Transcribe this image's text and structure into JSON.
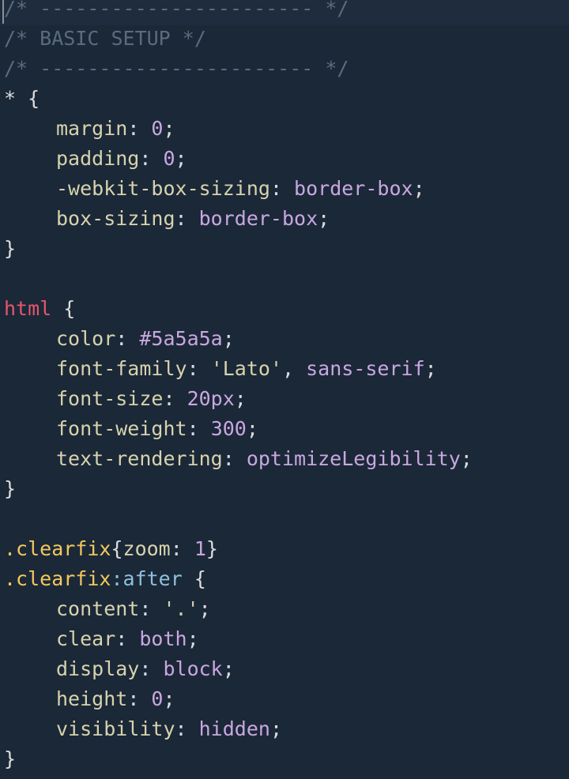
{
  "colors": {
    "background": "#1b2838",
    "comment": "#5b6b7c",
    "punctuation": "#dcdcdc",
    "property": "#d7d3ad",
    "value": "#c9a7e0",
    "number": "#c9a7e0",
    "tag": "#e5576b",
    "selector": "#f3c85c",
    "pseudo": "#8fc1dd",
    "string": "#d7d3ad"
  },
  "lines": [
    {
      "indent": false,
      "tokens": [
        {
          "t": "/* ----------------------- */",
          "c": "comment"
        }
      ]
    },
    {
      "indent": false,
      "tokens": [
        {
          "t": "/* BASIC SETUP */",
          "c": "comment"
        }
      ]
    },
    {
      "indent": false,
      "tokens": [
        {
          "t": "/* ----------------------- */",
          "c": "comment"
        }
      ]
    },
    {
      "indent": false,
      "tokens": [
        {
          "t": "* {",
          "c": "punctuation"
        }
      ]
    },
    {
      "indent": true,
      "tokens": [
        {
          "t": "margin",
          "c": "property"
        },
        {
          "t": ": ",
          "c": "punctuation"
        },
        {
          "t": "0",
          "c": "number"
        },
        {
          "t": ";",
          "c": "punctuation"
        }
      ]
    },
    {
      "indent": true,
      "tokens": [
        {
          "t": "padding",
          "c": "property"
        },
        {
          "t": ": ",
          "c": "punctuation"
        },
        {
          "t": "0",
          "c": "number"
        },
        {
          "t": ";",
          "c": "punctuation"
        }
      ]
    },
    {
      "indent": true,
      "tokens": [
        {
          "t": "-webkit-box-sizing",
          "c": "property"
        },
        {
          "t": ": ",
          "c": "punctuation"
        },
        {
          "t": "border-box",
          "c": "value"
        },
        {
          "t": ";",
          "c": "punctuation"
        }
      ]
    },
    {
      "indent": true,
      "tokens": [
        {
          "t": "box-sizing",
          "c": "property"
        },
        {
          "t": ": ",
          "c": "punctuation"
        },
        {
          "t": "border-box",
          "c": "value"
        },
        {
          "t": ";",
          "c": "punctuation"
        }
      ]
    },
    {
      "indent": false,
      "tokens": [
        {
          "t": "}",
          "c": "punctuation"
        }
      ]
    },
    {
      "indent": false,
      "tokens": []
    },
    {
      "indent": false,
      "tokens": [
        {
          "t": "html",
          "c": "tag"
        },
        {
          "t": " {",
          "c": "punctuation"
        }
      ]
    },
    {
      "indent": true,
      "tokens": [
        {
          "t": "color",
          "c": "property"
        },
        {
          "t": ": ",
          "c": "punctuation"
        },
        {
          "t": "#5a5a5a",
          "c": "value"
        },
        {
          "t": ";",
          "c": "punctuation"
        }
      ]
    },
    {
      "indent": true,
      "tokens": [
        {
          "t": "font-family",
          "c": "property"
        },
        {
          "t": ": ",
          "c": "punctuation"
        },
        {
          "t": "'Lato'",
          "c": "string"
        },
        {
          "t": ", ",
          "c": "punctuation"
        },
        {
          "t": "sans-serif",
          "c": "value"
        },
        {
          "t": ";",
          "c": "punctuation"
        }
      ]
    },
    {
      "indent": true,
      "tokens": [
        {
          "t": "font-size",
          "c": "property"
        },
        {
          "t": ": ",
          "c": "punctuation"
        },
        {
          "t": "20px",
          "c": "number"
        },
        {
          "t": ";",
          "c": "punctuation"
        }
      ]
    },
    {
      "indent": true,
      "tokens": [
        {
          "t": "font-weight",
          "c": "property"
        },
        {
          "t": ": ",
          "c": "punctuation"
        },
        {
          "t": "300",
          "c": "number"
        },
        {
          "t": ";",
          "c": "punctuation"
        }
      ]
    },
    {
      "indent": true,
      "tokens": [
        {
          "t": "text-rendering",
          "c": "property"
        },
        {
          "t": ": ",
          "c": "punctuation"
        },
        {
          "t": "optimizeLegibility",
          "c": "value"
        },
        {
          "t": ";",
          "c": "punctuation"
        }
      ]
    },
    {
      "indent": false,
      "tokens": [
        {
          "t": "}",
          "c": "punctuation"
        }
      ]
    },
    {
      "indent": false,
      "tokens": []
    },
    {
      "indent": false,
      "tokens": [
        {
          "t": ".clearfix",
          "c": "selector"
        },
        {
          "t": "{",
          "c": "punctuation"
        },
        {
          "t": "zoom",
          "c": "property"
        },
        {
          "t": ": ",
          "c": "punctuation"
        },
        {
          "t": "1",
          "c": "number"
        },
        {
          "t": "}",
          "c": "punctuation"
        }
      ]
    },
    {
      "indent": false,
      "tokens": [
        {
          "t": ".clearfix",
          "c": "selector"
        },
        {
          "t": ":after",
          "c": "pseudo"
        },
        {
          "t": " {",
          "c": "punctuation"
        }
      ]
    },
    {
      "indent": true,
      "tokens": [
        {
          "t": "content",
          "c": "property"
        },
        {
          "t": ": ",
          "c": "punctuation"
        },
        {
          "t": "'.'",
          "c": "string"
        },
        {
          "t": ";",
          "c": "punctuation"
        }
      ]
    },
    {
      "indent": true,
      "tokens": [
        {
          "t": "clear",
          "c": "property"
        },
        {
          "t": ": ",
          "c": "punctuation"
        },
        {
          "t": "both",
          "c": "value"
        },
        {
          "t": ";",
          "c": "punctuation"
        }
      ]
    },
    {
      "indent": true,
      "tokens": [
        {
          "t": "display",
          "c": "property"
        },
        {
          "t": ": ",
          "c": "punctuation"
        },
        {
          "t": "block",
          "c": "value"
        },
        {
          "t": ";",
          "c": "punctuation"
        }
      ]
    },
    {
      "indent": true,
      "tokens": [
        {
          "t": "height",
          "c": "property"
        },
        {
          "t": ": ",
          "c": "punctuation"
        },
        {
          "t": "0",
          "c": "number"
        },
        {
          "t": ";",
          "c": "punctuation"
        }
      ]
    },
    {
      "indent": true,
      "tokens": [
        {
          "t": "visibility",
          "c": "property"
        },
        {
          "t": ": ",
          "c": "punctuation"
        },
        {
          "t": "hidden",
          "c": "value"
        },
        {
          "t": ";",
          "c": "punctuation"
        }
      ]
    },
    {
      "indent": false,
      "tokens": [
        {
          "t": "}",
          "c": "punctuation"
        }
      ]
    }
  ]
}
